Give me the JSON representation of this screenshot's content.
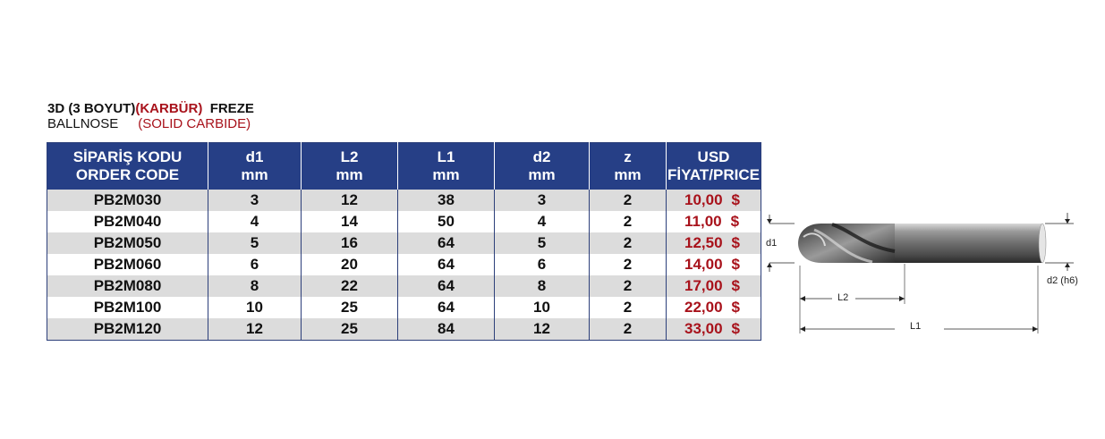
{
  "title": {
    "line1_a": "3D (3 BOYUT)",
    "line1_red": "(KARBÜR)",
    "line1_b": "FREZE",
    "line2_a": "BALLNOSE",
    "line2_red": "(SOLID CARBIDE)"
  },
  "table": {
    "headers": [
      {
        "l1": "SİPARİŞ KODU",
        "l2": "ORDER CODE"
      },
      {
        "l1": "d1",
        "l2": "mm"
      },
      {
        "l1": "L2",
        "l2": "mm"
      },
      {
        "l1": "L1",
        "l2": "mm"
      },
      {
        "l1": "d2",
        "l2": "mm"
      },
      {
        "l1": "z",
        "l2": "mm"
      },
      {
        "l1": "USD",
        "l2": "FİYAT/PRICE"
      }
    ],
    "currency": "$",
    "rows": [
      {
        "code": "PB2M030",
        "d1": "3",
        "l2": "12",
        "l1": "38",
        "d2": "3",
        "z": "2",
        "price": "10,00"
      },
      {
        "code": "PB2M040",
        "d1": "4",
        "l2": "14",
        "l1": "50",
        "d2": "4",
        "z": "2",
        "price": "11,00"
      },
      {
        "code": "PB2M050",
        "d1": "5",
        "l2": "16",
        "l1": "64",
        "d2": "5",
        "z": "2",
        "price": "12,50"
      },
      {
        "code": "PB2M060",
        "d1": "6",
        "l2": "20",
        "l1": "64",
        "d2": "6",
        "z": "2",
        "price": "14,00"
      },
      {
        "code": "PB2M080",
        "d1": "8",
        "l2": "22",
        "l1": "64",
        "d2": "8",
        "z": "2",
        "price": "17,00"
      },
      {
        "code": "PB2M100",
        "d1": "10",
        "l2": "25",
        "l1": "64",
        "d2": "10",
        "z": "2",
        "price": "22,00"
      },
      {
        "code": "PB2M120",
        "d1": "12",
        "l2": "25",
        "l1": "84",
        "d2": "12",
        "z": "2",
        "price": "33,00"
      }
    ]
  },
  "diagram": {
    "d1_label": "d1",
    "d2_label": "d2 (h6)",
    "l2_label": "L2",
    "l1_label": "L1"
  },
  "colors": {
    "header_bg": "#263f86",
    "price_red": "#a8121b",
    "stripe": "#dcdcdc"
  }
}
